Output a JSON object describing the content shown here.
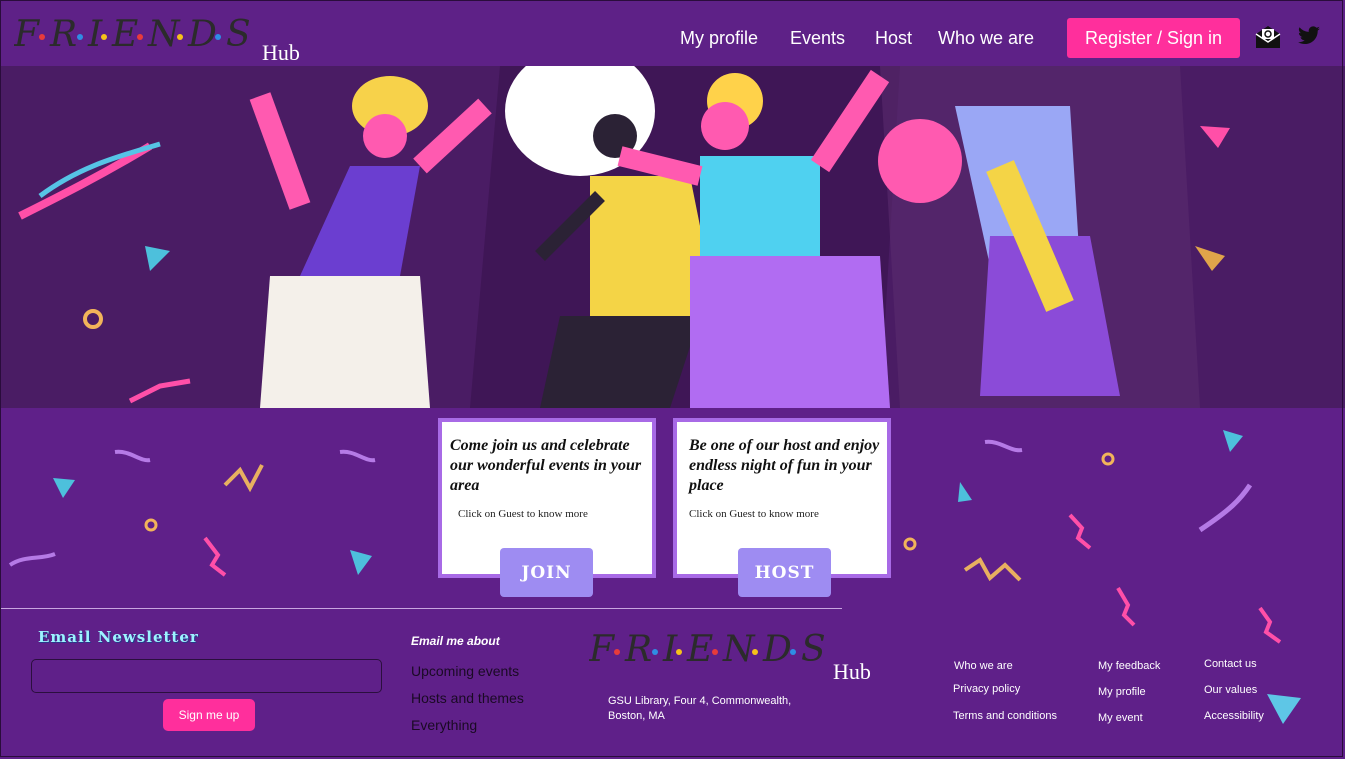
{
  "header": {
    "logo_text": "F·R·I·E·N·D·S",
    "logo_sub": "Hub",
    "nav": [
      "My profile",
      "Events",
      "Host",
      "Who we are"
    ],
    "register_label": "Register / Sign in",
    "icons": [
      "mail-icon",
      "twitter-icon"
    ]
  },
  "cards": [
    {
      "title": "Come join us and celebrate our wonderful events in your area",
      "subtitle": "Click on Guest to know more",
      "button": "JOIN"
    },
    {
      "title": "Be one of our host and enjoy  endless night of fun in your place",
      "subtitle": "Click on Guest to know more",
      "button": "HOST"
    }
  ],
  "footer": {
    "newsletter_title": "Email Newsletter",
    "newsletter_value": "",
    "signup_label": "Sign me up",
    "email_me_title": "Email me about",
    "email_options": [
      "Upcoming events",
      "Hosts and themes",
      "Everything"
    ],
    "logo_text": "F·R·I·E·N·D·S",
    "logo_sub": "Hub",
    "address": "GSU Library, Four 4, Commonwealth, Boston, MA",
    "links_col1": [
      "Who we are",
      "Privacy policy",
      "Terms and conditions"
    ],
    "links_col2": [
      "My feedback",
      "My profile",
      "My event"
    ],
    "links_col3": [
      "Contact us",
      "Our values",
      "Accessibility"
    ]
  },
  "colors": {
    "background": "#5f2089",
    "accent_pink": "#ff2f9c",
    "card_button": "#9e8cf2",
    "card_border": "#a86ae6",
    "newsletter_title": "#9df4ff"
  }
}
